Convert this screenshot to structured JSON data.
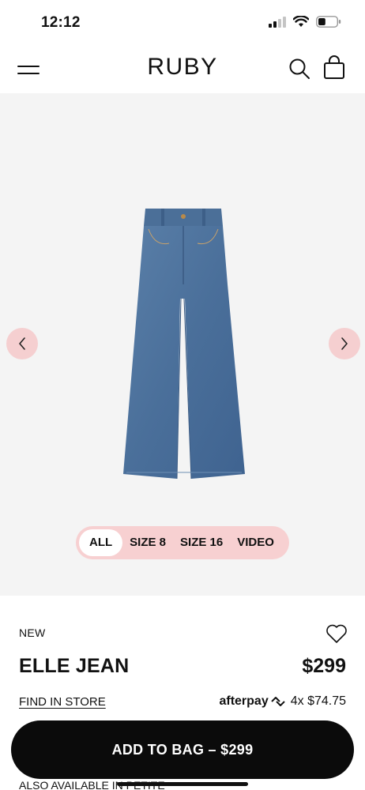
{
  "status_bar": {
    "time": "12:12",
    "battery_level": 0.4
  },
  "header": {
    "brand": "RUBY",
    "icons": [
      "menu-icon",
      "search-icon",
      "bag-icon"
    ]
  },
  "gallery": {
    "image_alt": "ELLE JEAN wide-leg denim",
    "filters": [
      "ALL",
      "SIZE 8",
      "SIZE 16",
      "VIDEO"
    ],
    "active_filter": "ALL",
    "colors": {
      "background": "#f4f4f4",
      "accent": "#f7d0d1",
      "denim": "#4a6f9a"
    }
  },
  "product": {
    "badge": "NEW",
    "name": "ELLE JEAN",
    "price": "$299",
    "find_in_store": "FIND IN STORE",
    "afterpay": {
      "logo": "afterpay",
      "installments": "4x $74.75"
    }
  },
  "cta": {
    "label": "ADD TO BAG – $299"
  },
  "also_available": "ALSO AVAILABLE IN PETITE"
}
